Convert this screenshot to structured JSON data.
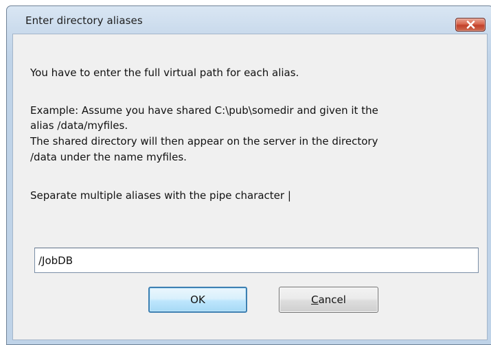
{
  "dialog": {
    "title": "Enter directory aliases",
    "close_icon": "close-x-icon",
    "messages": {
      "line1": "You have to enter the full virtual path for each alias.",
      "line2": "Example: Assume you have shared C:\\pub\\somedir and given it the",
      "line3": "alias /data/myfiles.",
      "line4": "The shared directory will then appear on the server in the directory",
      "line5": "/data under the name myfiles.",
      "line6": "Separate multiple aliases with the pipe character |"
    },
    "alias_input": {
      "value": "/JobDB"
    },
    "buttons": {
      "ok": "OK",
      "cancel_first_letter": "C",
      "cancel_rest": "ancel"
    }
  },
  "colors": {
    "title_bar": "#c9daec",
    "client_background": "#f0f0f0",
    "close_button": "#c1412b",
    "default_button_border": "#3c7fb1"
  }
}
